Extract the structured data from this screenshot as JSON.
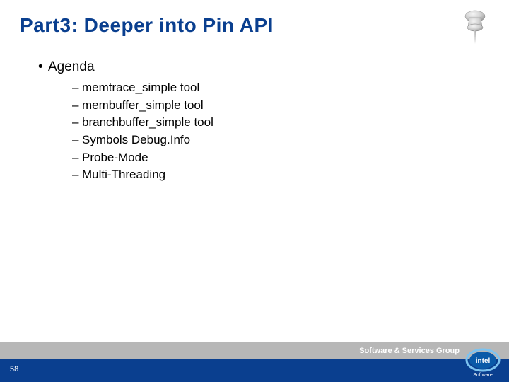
{
  "title": "Part3: Deeper into Pin API",
  "agenda_label": "Agenda",
  "agenda_items": [
    "memtrace_simple  tool",
    "membuffer_simple tool",
    "branchbuffer_simple tool",
    "Symbols Debug.Info",
    "Probe-Mode",
    "Multi-Threading"
  ],
  "footer_group": "Software & Services Group",
  "page_number": "58",
  "logo_text": "intel",
  "logo_sub": "Software"
}
